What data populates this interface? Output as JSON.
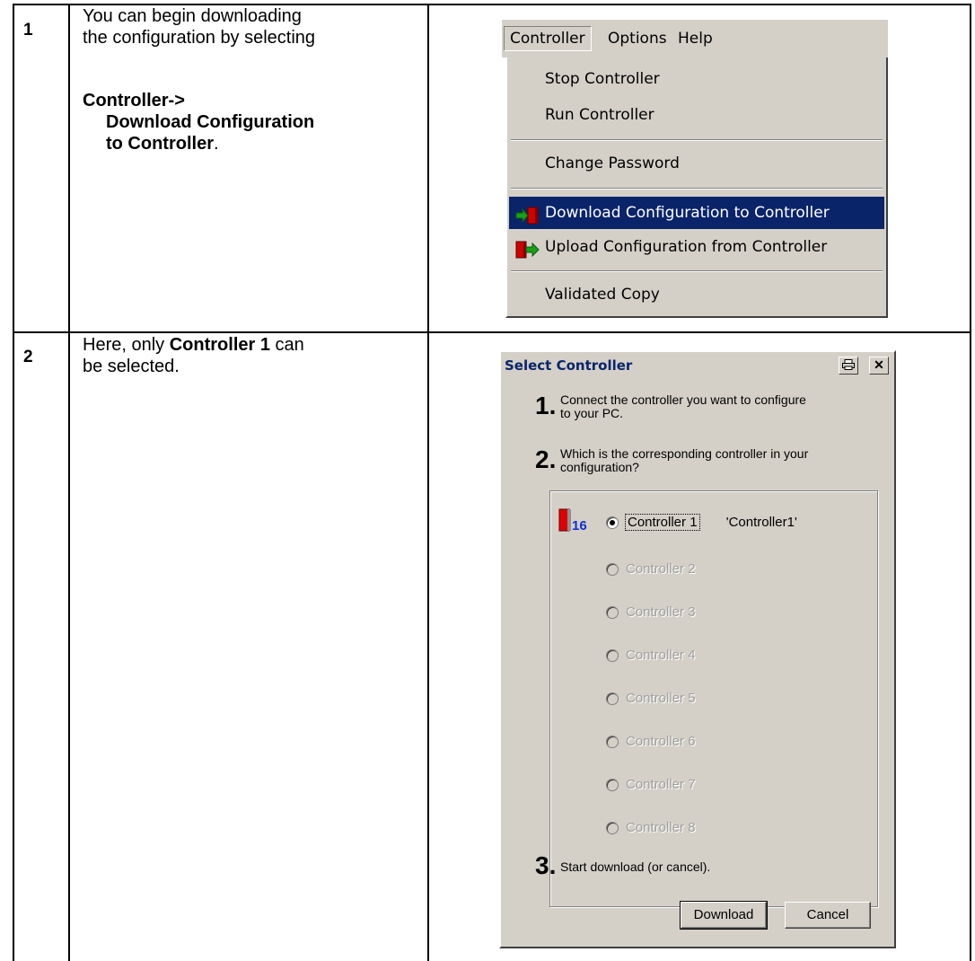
{
  "rows": [
    {
      "number": "1",
      "text_lines": [
        "You can begin downloading",
        "the configuration by selecting"
      ],
      "path_1": "Controller->",
      "path_2": "Download Configuration",
      "path_3": "to Controller",
      "path_end": "."
    },
    {
      "number": "2",
      "text_pre": "Here, only ",
      "text_bold": "Controller 1",
      "text_post": " can",
      "text_line2": "be selected."
    }
  ],
  "menubar": {
    "items": [
      "Controller",
      "Options",
      "Help"
    ]
  },
  "menu": {
    "items": [
      {
        "label": "Stop Controller",
        "icon": ""
      },
      {
        "label": "Run Controller",
        "icon": ""
      },
      {
        "label": "Change Password",
        "icon": ""
      },
      {
        "label": "Download Configuration to Controller",
        "icon": "download-config-icon",
        "highlighted": true
      },
      {
        "label": "Upload Configuration from Controller",
        "icon": "upload-config-icon"
      },
      {
        "label": "Validated Copy",
        "icon": ""
      }
    ]
  },
  "dialog": {
    "title": "Select Controller",
    "step1_num": "1.",
    "step1_text_a": "Connect the controller you want to configure",
    "step1_text_b": "to your PC.",
    "step2_num": "2.",
    "step2_text_a": "Which is the corresponding controller in your",
    "step2_text_b": "configuration?",
    "controller_icon_badge": "16",
    "options": [
      {
        "label": "Controller 1",
        "name": "'Controller1'",
        "selected": true,
        "enabled": true
      },
      {
        "label": "Controller 2",
        "enabled": false
      },
      {
        "label": "Controller 3",
        "enabled": false
      },
      {
        "label": "Controller 4",
        "enabled": false
      },
      {
        "label": "Controller 5",
        "enabled": false
      },
      {
        "label": "Controller 6",
        "enabled": false
      },
      {
        "label": "Controller 7",
        "enabled": false
      },
      {
        "label": "Controller 8",
        "enabled": false
      }
    ],
    "step3_num": "3.",
    "step3_text": "Start download (or cancel).",
    "download_button": "Download",
    "cancel_button": "Cancel"
  },
  "colors": {
    "highlight": "#0a246a",
    "face": "#d4d0c8"
  }
}
